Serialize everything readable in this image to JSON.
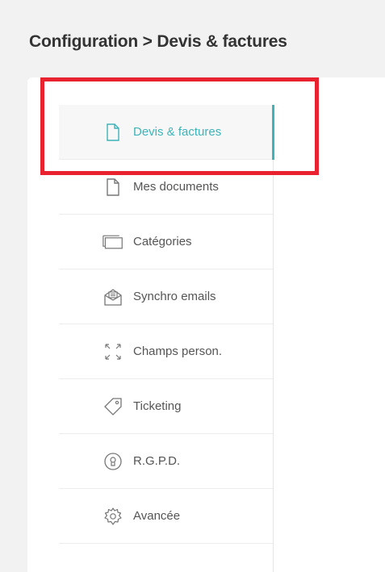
{
  "breadcrumb": "Configuration > Devis & factures",
  "menu": {
    "items": [
      {
        "label": "Devis & factures",
        "icon": "document-icon",
        "active": true
      },
      {
        "label": "Mes documents",
        "icon": "document-icon"
      },
      {
        "label": "Catégories",
        "icon": "folder-icon"
      },
      {
        "label": "Synchro emails",
        "icon": "email-sync-icon"
      },
      {
        "label": "Champs person.",
        "icon": "expand-icon"
      },
      {
        "label": "Ticketing",
        "icon": "tag-icon"
      },
      {
        "label": "R.G.P.D.",
        "icon": "lock-badge-icon"
      },
      {
        "label": "Avancée",
        "icon": "gear-icon"
      }
    ]
  },
  "colors": {
    "accent": "#3fb3b8",
    "highlight": "#e8232f",
    "text": "#555555"
  }
}
